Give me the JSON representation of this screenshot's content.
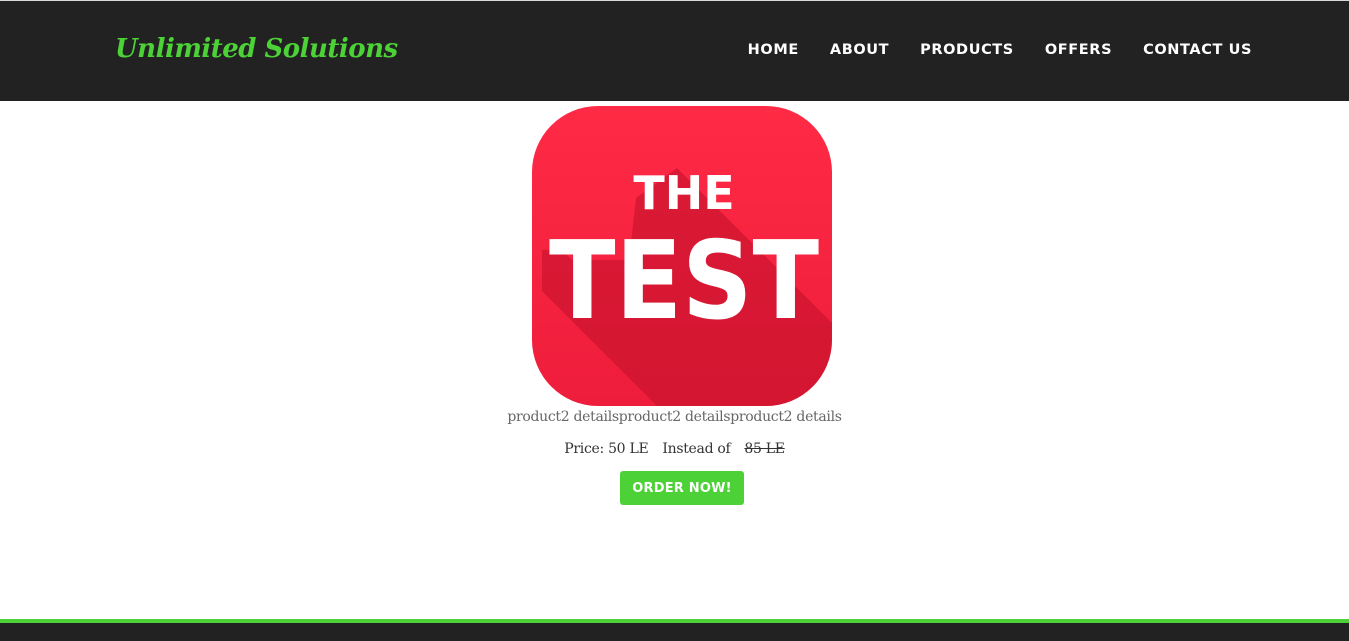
{
  "header": {
    "brand": "Unlimited Solutions",
    "nav": [
      "HOME",
      "ABOUT",
      "PRODUCTS",
      "OFFERS",
      "CONTACT US"
    ]
  },
  "product": {
    "logo_text_top": "THE",
    "logo_text_bottom": "TEST",
    "details": "product2 detailsproduct2 detailsproduct2 details",
    "price_label": "Price: 50 LE",
    "instead_label": "Instead of",
    "old_price": "85 LE",
    "order_button": "ORDER NOW!"
  },
  "colors": {
    "accent": "#4cd137",
    "header_bg": "#222222",
    "logo_red": "#ff2a45"
  }
}
